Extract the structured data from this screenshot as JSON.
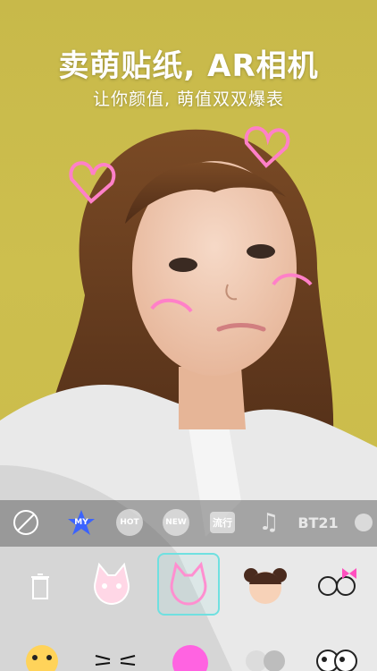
{
  "hero": {
    "title": "卖萌贴纸, AR相机",
    "subtitle": "让你颜值, 萌值双双爆表"
  },
  "categories": [
    {
      "name": "none",
      "label": ""
    },
    {
      "name": "my",
      "label": "MY"
    },
    {
      "name": "hot",
      "label": "HOT"
    },
    {
      "name": "new",
      "label": "NEW"
    },
    {
      "name": "trend",
      "label": "流行"
    },
    {
      "name": "music",
      "label": ""
    },
    {
      "name": "bt21",
      "label": "BT21"
    }
  ],
  "colors": {
    "background": "#cdbf4e",
    "accent_blue": "#3b63ff",
    "selection": "#6fe0e0"
  }
}
